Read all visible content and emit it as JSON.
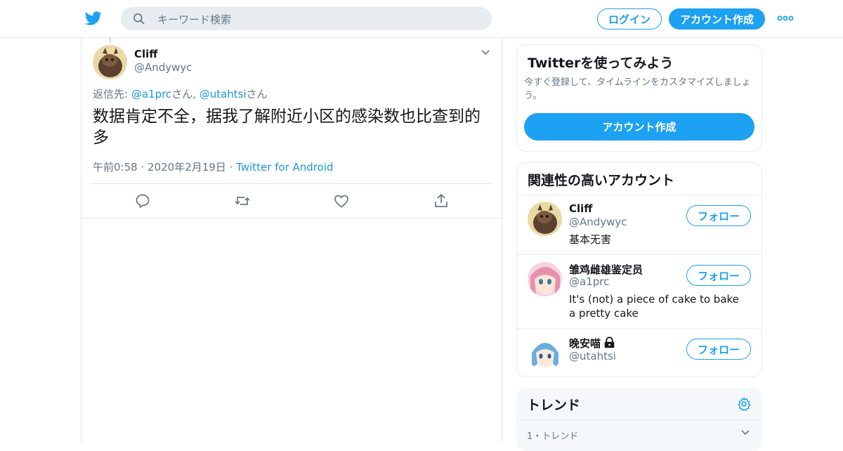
{
  "header": {
    "search_placeholder": "キーワード検索",
    "login_label": "ログイン",
    "signup_label": "アカウント作成"
  },
  "tweet": {
    "author_name": "Cliff",
    "author_handle": "@Andywyc",
    "reply_prefix": "返信先: ",
    "reply_user1": "@a1prc",
    "reply_san1": "さん, ",
    "reply_user2": "@utahtsi",
    "reply_san2": "さん",
    "text": "数据肯定不全，据我了解附近小区的感染数也比查到的多",
    "time": "午前0:58 · 2020年2月19日 · ",
    "source": "Twitter for Android"
  },
  "signup_card": {
    "title": "Twitterを使ってみよう",
    "subtitle": "今すぐ登録して、タイムラインをカスタマイズしましょう。",
    "button": "アカウント作成"
  },
  "related": {
    "title": "関連性の高いアカウント",
    "follow_label": "フォロー",
    "accounts": [
      {
        "name": "Cliff",
        "handle": "@Andywyc",
        "bio": "基本无害"
      },
      {
        "name": "雏鸡雌雄鉴定员",
        "handle": "@a1prc",
        "bio": "It's (not) a piece of cake to bake a pretty cake"
      },
      {
        "name": "晚安喵",
        "handle": "@utahtsi",
        "bio": ""
      }
    ]
  },
  "trends": {
    "title": "トレンド",
    "item1_label": "1・トレンド"
  },
  "colors": {
    "accent": "#1da1f2",
    "link": "#1b95e0",
    "muted": "#657786"
  }
}
